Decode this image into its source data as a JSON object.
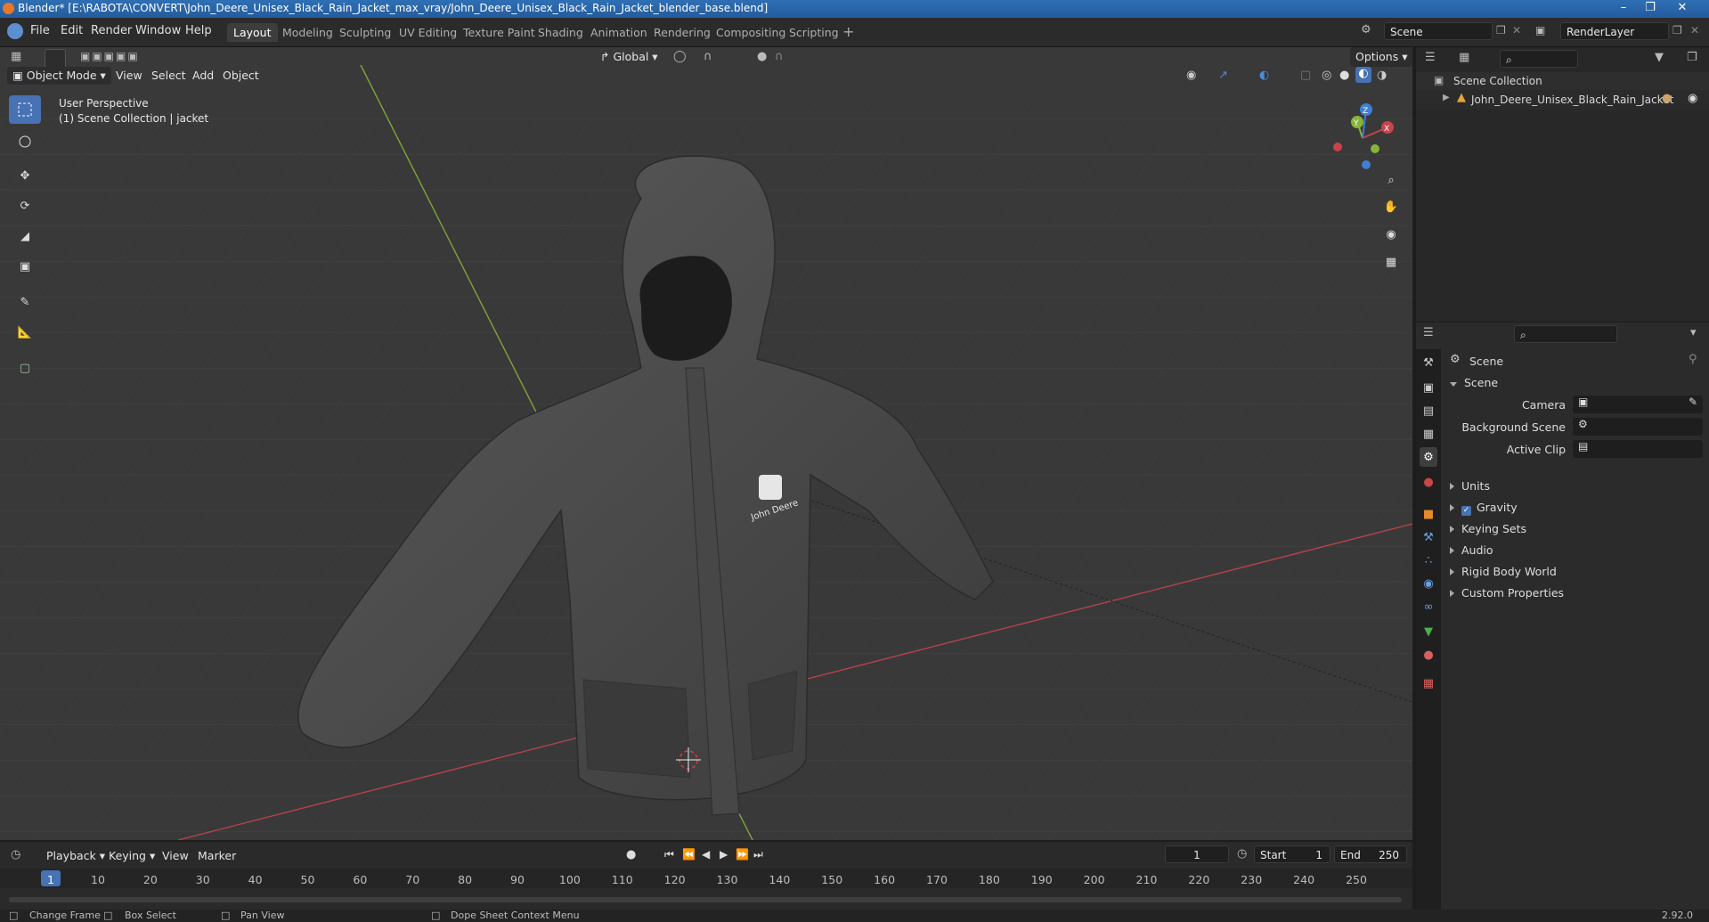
{
  "titlebar": {
    "text": "Blender* [E:\\RABOTA\\CONVERT\\John_Deere_Unisex_Black_Rain_Jacket_max_vray/John_Deere_Unisex_Black_Rain_Jacket_blender_base.blend]"
  },
  "menus": [
    "File",
    "Edit",
    "Render",
    "Window",
    "Help"
  ],
  "workspaces": [
    "Layout",
    "Modeling",
    "Sculpting",
    "UV Editing",
    "Texture Paint",
    "Shading",
    "Animation",
    "Rendering",
    "Compositing",
    "Scripting"
  ],
  "scene_name": "Scene",
  "render_layer": "RenderLayer",
  "viewport": {
    "mode": "Object Mode",
    "menus": [
      "View",
      "Select",
      "Add",
      "Object"
    ],
    "orientation": "Global",
    "options_label": "Options",
    "overlay_line1": "User Perspective",
    "overlay_line2": "(1) Scene Collection | jacket",
    "gizmo_labels": {
      "x": "X",
      "y": "Y",
      "z": "Z"
    },
    "logo_text": "John Deere"
  },
  "timeline": {
    "menus": [
      "Playback",
      "Keying",
      "View",
      "Marker"
    ],
    "current_frame": "1",
    "start_label": "Start",
    "start_value": "1",
    "end_label": "End",
    "end_value": "250",
    "ticks": [
      "1",
      "10",
      "20",
      "30",
      "40",
      "50",
      "60",
      "70",
      "80",
      "90",
      "100",
      "110",
      "120",
      "130",
      "140",
      "150",
      "160",
      "170",
      "180",
      "190",
      "200",
      "210",
      "220",
      "230",
      "240",
      "250"
    ]
  },
  "status": {
    "items": [
      "Change Frame",
      "Box Select",
      "Pan View",
      "Dope Sheet Context Menu"
    ],
    "version": "2.92.0"
  },
  "outliner": {
    "root": "Scene Collection",
    "item": "John_Deere_Unisex_Black_Rain_Jacket"
  },
  "properties": {
    "context": "Scene",
    "panel_title": "Scene",
    "fields": [
      {
        "label": "Camera",
        "value": ""
      },
      {
        "label": "Background Scene",
        "value": ""
      },
      {
        "label": "Active Clip",
        "value": ""
      }
    ],
    "collapsed_panels": [
      "Units",
      "Gravity",
      "Keying Sets",
      "Audio",
      "Rigid Body World",
      "Custom Properties"
    ],
    "gravity_checked": true
  },
  "colors": {
    "accent": "#4772b3",
    "viewport_bg": "#393939",
    "x_axis": "#c8434b",
    "y_axis": "#86b33a",
    "z_axis": "#3f7fd4"
  }
}
